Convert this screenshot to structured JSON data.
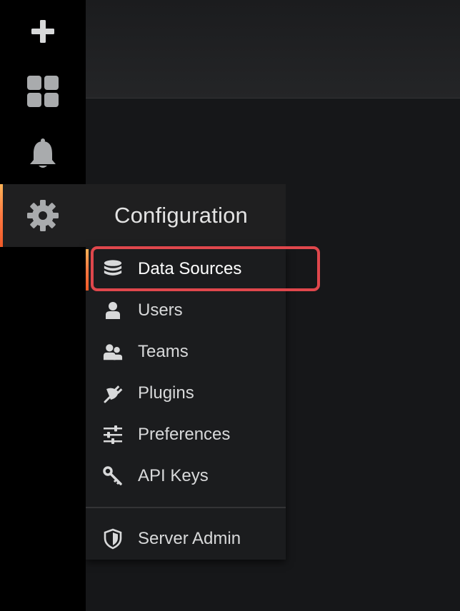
{
  "sidebar": {
    "icons": [
      {
        "name": "plus-icon"
      },
      {
        "name": "dashboards-icon"
      },
      {
        "name": "bell-icon"
      },
      {
        "name": "gear-icon",
        "active": true
      }
    ]
  },
  "config_menu": {
    "title": "Configuration",
    "items": [
      {
        "label": "Data Sources",
        "icon": "database-icon",
        "active": true
      },
      {
        "label": "Users",
        "icon": "user-icon"
      },
      {
        "label": "Teams",
        "icon": "users-icon"
      },
      {
        "label": "Plugins",
        "icon": "plug-icon"
      },
      {
        "label": "Preferences",
        "icon": "sliders-icon"
      },
      {
        "label": "API Keys",
        "icon": "key-icon"
      }
    ],
    "admin": {
      "label": "Server Admin",
      "icon": "shield-icon"
    }
  },
  "colors": {
    "accent_gradient": [
      "#ffb357",
      "#ff7941",
      "#f05a28"
    ],
    "highlight": "#e0474c",
    "sidebar_bg": "#000000",
    "main_bg": "#161719",
    "menu_bg": "#1b1c1e"
  }
}
